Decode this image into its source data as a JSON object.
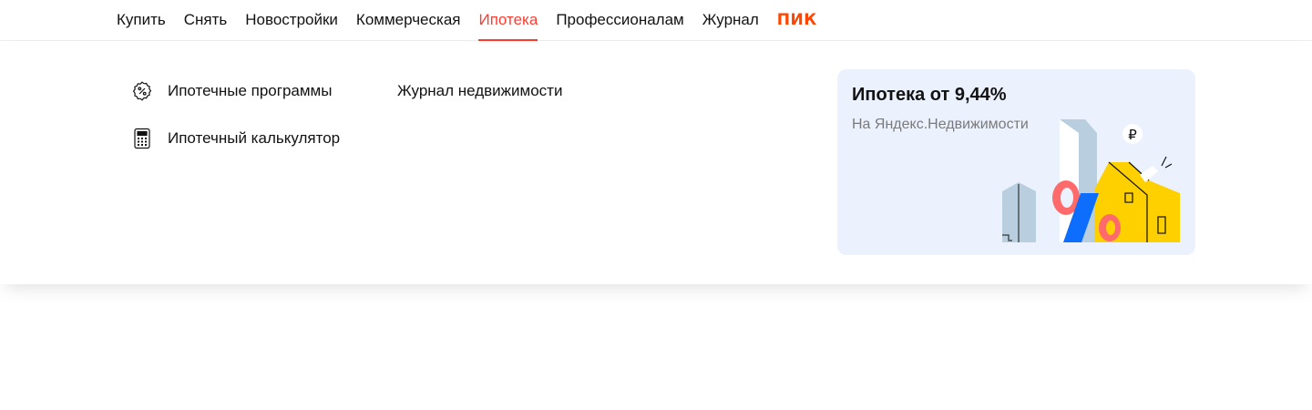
{
  "nav": {
    "items": [
      {
        "label": "Купить",
        "active": false
      },
      {
        "label": "Снять",
        "active": false
      },
      {
        "label": "Новостройки",
        "active": false
      },
      {
        "label": "Коммерческая",
        "active": false
      },
      {
        "label": "Ипотека",
        "active": true
      },
      {
        "label": "Профессионалам",
        "active": false
      },
      {
        "label": "Журнал",
        "active": false
      }
    ],
    "brand_label": "ПИК",
    "active_color": "#ff3b30",
    "brand_color": "#ff4500"
  },
  "dropdown": {
    "col1": [
      {
        "label": "Ипотечные программы",
        "icon": "percent-badge-icon"
      },
      {
        "label": "Ипотечный калькулятор",
        "icon": "calculator-icon"
      }
    ],
    "col2": [
      {
        "label": "Журнал недвижимости"
      }
    ],
    "promo": {
      "title": "Ипотека от 9,44%",
      "subtitle": "На Яндекс.Недвижимости",
      "background": "#ebf2fe",
      "illustration": "houses-percent-illustration"
    }
  }
}
